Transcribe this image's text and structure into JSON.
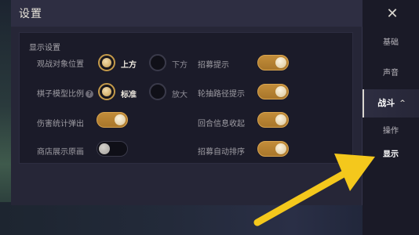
{
  "dialog": {
    "title": "设置",
    "close_label": "✕"
  },
  "display_settings": {
    "section_title": "显示设置",
    "view_target": {
      "label": "观战对象位置",
      "options": [
        "上方",
        "下方"
      ],
      "selected": "上方"
    },
    "piece_scale": {
      "label": "棋子模型比例",
      "help": "?",
      "options": [
        "标准",
        "放大"
      ],
      "selected": "标准"
    },
    "damage_popup": {
      "label": "伤害统计弹出",
      "on": true
    },
    "shop_art": {
      "label": "商店展示原画",
      "on": false
    },
    "recruit_tip": {
      "label": "招募提示",
      "on": true
    },
    "carousel_path_tip": {
      "label": "轮抽路径提示",
      "on": true
    },
    "round_info_collapse": {
      "label": "回合信息收起",
      "on": true
    },
    "recruit_auto_sort": {
      "label": "招募自动排序",
      "on": true
    }
  },
  "nav": {
    "items": [
      {
        "label": "基础"
      },
      {
        "label": "声音"
      },
      {
        "label": "战斗",
        "expanded": true
      },
      {
        "label": "操作"
      },
      {
        "label": "显示",
        "selected": true
      }
    ],
    "expand_icon": "^"
  },
  "colors": {
    "accent": "#c28d3a",
    "arrow": "#f4c81c"
  }
}
